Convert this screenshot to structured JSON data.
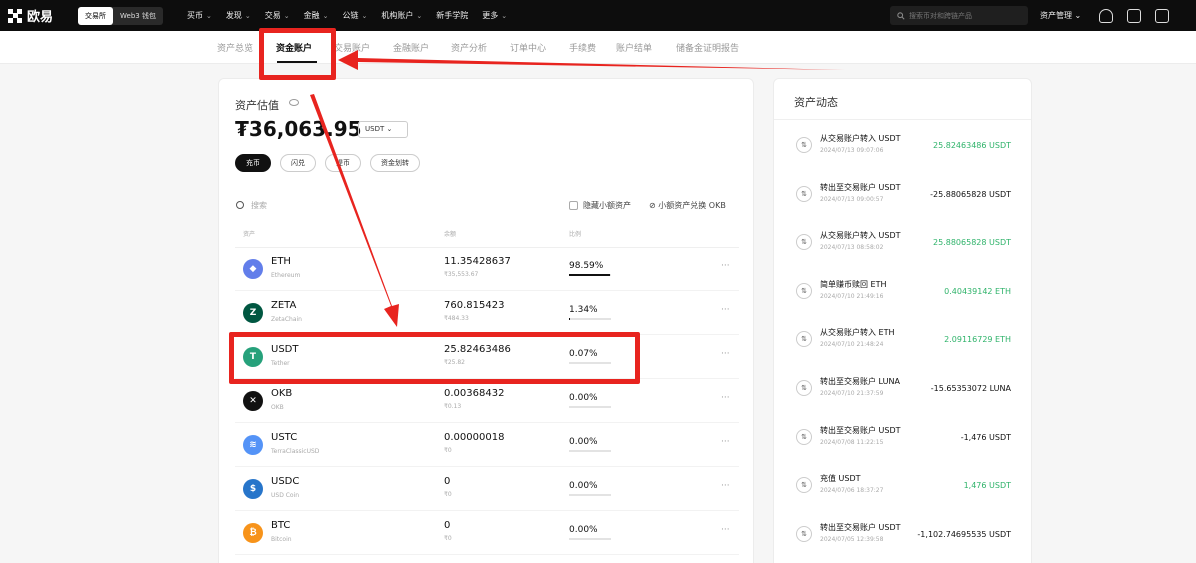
{
  "brand": {
    "name": "欧易",
    "mode_exchange": "交易所",
    "mode_wallet": "Web3 钱包"
  },
  "nav": [
    "买币",
    "发现",
    "交易",
    "金融",
    "公链",
    "机构账户",
    "新手学院",
    "更多"
  ],
  "search": {
    "placeholder": "搜索币对和跨链产品"
  },
  "top_right": {
    "asset_mgmt": "资产管理"
  },
  "subnav": [
    "资产总览",
    "资金账户",
    "交易账户",
    "金融账户",
    "资产分析",
    "订单中心",
    "手续费",
    "账户结单",
    "储备金证明报告"
  ],
  "valuation": {
    "label": "资产估值",
    "value": "₮36,063.95",
    "currency": "USDT",
    "pills": [
      "充币",
      "闪兑",
      "提币",
      "资金划转"
    ]
  },
  "filter": {
    "search_label": "搜索",
    "hide_small": "隐藏小额资产",
    "okb_convert": "小额资产兑换 OKB"
  },
  "columns": [
    "资产",
    "余额",
    "比例"
  ],
  "assets": [
    {
      "symbol": "ETH",
      "name": "Ethereum",
      "balance": "11.35428637",
      "value": "₹35,553.67",
      "pct": "98.59%",
      "fraction": 0.9859,
      "icon": "eth-icon",
      "color": "#627eea",
      "glyph": "◆"
    },
    {
      "symbol": "ZETA",
      "name": "ZetaChain",
      "balance": "760.815423",
      "value": "₹484.33",
      "pct": "1.34%",
      "fraction": 0.0134,
      "icon": "zeta-icon",
      "color": "#005741",
      "glyph": "Z"
    },
    {
      "symbol": "USDT",
      "name": "Tether",
      "balance": "25.82463486",
      "value": "₹25.82",
      "pct": "0.07%",
      "fraction": 0.0007,
      "icon": "tether-icon",
      "color": "#26a17b",
      "glyph": "T"
    },
    {
      "symbol": "OKB",
      "name": "OKB",
      "balance": "0.00368432",
      "value": "₹0.13",
      "pct": "0.00%",
      "fraction": 0,
      "icon": "okb-icon",
      "color": "#111111",
      "glyph": "✕"
    },
    {
      "symbol": "USTC",
      "name": "TerraClassicUSD",
      "balance": "0.00000018",
      "value": "₹0",
      "pct": "0.00%",
      "fraction": 0,
      "icon": "ustc-icon",
      "color": "#5493f7",
      "glyph": "≋"
    },
    {
      "symbol": "USDC",
      "name": "USD Coin",
      "balance": "0",
      "value": "₹0",
      "pct": "0.00%",
      "fraction": 0,
      "icon": "usdc-icon",
      "color": "#2775ca",
      "glyph": "$"
    },
    {
      "symbol": "BTC",
      "name": "Bitcoin",
      "balance": "0",
      "value": "₹0",
      "pct": "0.00%",
      "fraction": 0,
      "icon": "btc-icon",
      "color": "#f7931a",
      "glyph": "₿"
    }
  ],
  "activity": {
    "title": "资产动态",
    "items": [
      {
        "title": "从交易账户转入 USDT",
        "date": "2024/07/13 09:07:06",
        "amount": "25.82463486 USDT",
        "sign": "pos"
      },
      {
        "title": "转出至交易账户 USDT",
        "date": "2024/07/13 09:00:57",
        "amount": "-25.88065828 USDT",
        "sign": "neg"
      },
      {
        "title": "从交易账户转入 USDT",
        "date": "2024/07/13 08:58:02",
        "amount": "25.88065828 USDT",
        "sign": "pos"
      },
      {
        "title": "简单赚币赎回 ETH",
        "date": "2024/07/10 21:49:16",
        "amount": "0.40439142 ETH",
        "sign": "pos"
      },
      {
        "title": "从交易账户转入 ETH",
        "date": "2024/07/10 21:48:24",
        "amount": "2.09116729 ETH",
        "sign": "pos"
      },
      {
        "title": "转出至交易账户 LUNA",
        "date": "2024/07/10 21:37:59",
        "amount": "-15.65353072 LUNA",
        "sign": "neg"
      },
      {
        "title": "转出至交易账户 USDT",
        "date": "2024/07/08 11:22:15",
        "amount": "-1,476 USDT",
        "sign": "neg"
      },
      {
        "title": "充值 USDT",
        "date": "2024/07/06 18:37:27",
        "amount": "1,476 USDT",
        "sign": "pos"
      },
      {
        "title": "转出至交易账户 USDT",
        "date": "2024/07/05 12:39:58",
        "amount": "-1,102.74695535 USDT",
        "sign": "neg"
      }
    ]
  },
  "annotation_color": "#e8241f"
}
